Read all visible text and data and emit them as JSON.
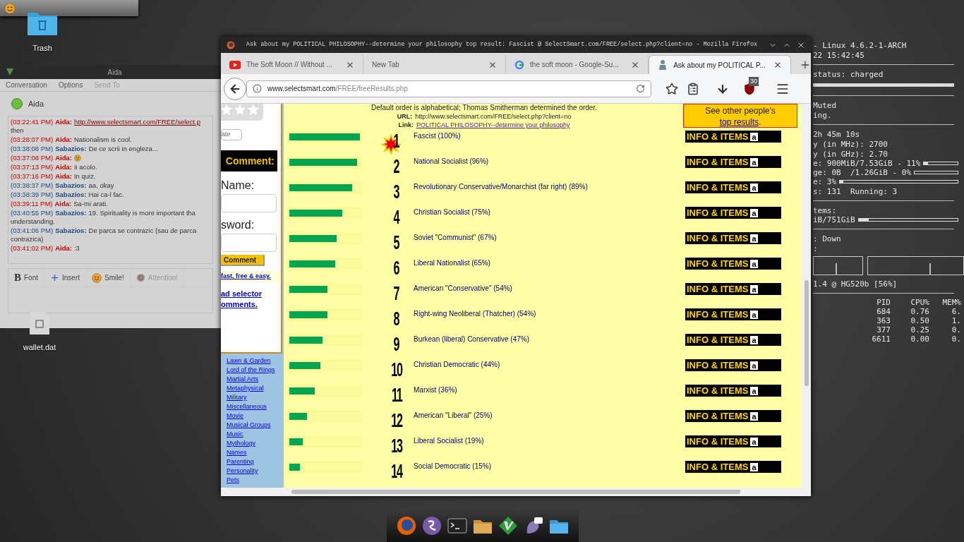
{
  "desktop": {
    "icons": [
      {
        "label": "Trash",
        "kind": "trash"
      },
      {
        "label": "wallet.dat",
        "kind": "file"
      }
    ]
  },
  "conky": [
    {
      "kind": "text",
      "text": "- Linux 4.6.2-1-ARCH"
    },
    {
      "kind": "text",
      "text": "22 15:42:45"
    },
    {
      "kind": "rule"
    },
    {
      "kind": "text",
      "text": "status: charged"
    },
    {
      "kind": "bar",
      "level": 1
    },
    {
      "kind": "rule"
    },
    {
      "kind": "text",
      "text": "Muted"
    },
    {
      "kind": "text",
      "text": "ing."
    },
    {
      "kind": "rule"
    },
    {
      "kind": "text",
      "text": "2h 45m 10s"
    },
    {
      "kind": "text",
      "text": "y (in MHz): 2700"
    },
    {
      "kind": "text",
      "text": "y (in GHz): 2.70"
    },
    {
      "kind": "meter",
      "text": "e: 900MiB/7.53GiB - 11%",
      "level": 0.11
    },
    {
      "kind": "meter",
      "text": "ge: 0B  /1.26GiB - 0%"
    },
    {
      "kind": "meter",
      "text": "e: 3%",
      "level": 0.03
    },
    {
      "kind": "text",
      "text": "s: 131  Running: 3"
    },
    {
      "kind": "rule"
    },
    {
      "kind": "text",
      "text": "tems:"
    },
    {
      "kind": "meter",
      "text": "iB/751GiB",
      "level": 0.1
    },
    {
      "kind": "rule"
    },
    {
      "kind": "text",
      "text": ": Down"
    },
    {
      "kind": "text",
      "text": ":"
    },
    {
      "kind": "graphs"
    },
    {
      "kind": "text",
      "text": "1.4 @ HG520b [56%]"
    },
    {
      "kind": "rule"
    },
    {
      "kind": "table",
      "columns": [
        "PID",
        "CPU%",
        "MEM%"
      ],
      "rows": [
        [
          "684",
          "0.76",
          "6."
        ],
        [
          "363",
          "0.50",
          "1."
        ],
        [
          "377",
          "0.25",
          "0."
        ],
        [
          "6611",
          "0.00",
          "0."
        ]
      ]
    }
  ],
  "chat": {
    "title": "Aida",
    "menu": [
      {
        "label": "Conversation",
        "disabled": false
      },
      {
        "label": "Options",
        "disabled": false
      },
      {
        "label": "Send To",
        "disabled": true
      }
    ],
    "buddy": {
      "name": "Aida",
      "online": true
    },
    "messages": [
      {
        "time": "(03:22:41 PM)",
        "sender": "Aida:",
        "kind": "received",
        "link": "http://www.selectsmart.com/FREE/select.p",
        "continuation": "then"
      },
      {
        "time": "(03:28:07 PM)",
        "sender": "Aida:",
        "kind": "received",
        "text": "Nationalism is cool."
      },
      {
        "time": "(03:38:08 PM)",
        "sender": "Sabazios:",
        "kind": "sent",
        "text": "De ce scrii in engleza..."
      },
      {
        "time": "(03:37:08 PM)",
        "sender": "Aida:",
        "kind": "received",
        "emoticon": true
      },
      {
        "time": "(03:37:13 PM)",
        "sender": "Aida:",
        "kind": "received",
        "text": "Ii acolo."
      },
      {
        "time": "(03:37:16 PM)",
        "sender": "Aida:",
        "kind": "received",
        "text": "In quiz."
      },
      {
        "time": "(03:38:37 PM)",
        "sender": "Sabazios:",
        "kind": "sent",
        "text": "aa, okay"
      },
      {
        "time": "(03:38:39 PM)",
        "sender": "Sabazios:",
        "kind": "sent",
        "text": "Hai ca-l fac."
      },
      {
        "time": "(03:39:11 PM)",
        "sender": "Aida:",
        "kind": "received",
        "text": "Sa-mi arati."
      },
      {
        "time": "(03:40:55 PM)",
        "sender": "Sabazios:",
        "kind": "sent",
        "text": "19. Spirituality is more important tha",
        "continuation": "understanding."
      },
      {
        "time": "(03:41:06 PM)",
        "sender": "Sabazios:",
        "kind": "sent",
        "text": "De parca se contrazic (sau de parca",
        "continuation": "contrazica)"
      },
      {
        "time": "(03:41:02 PM)",
        "sender": "Aida:",
        "kind": "received",
        "text": ":3"
      }
    ],
    "toolbar": [
      {
        "label": "Font",
        "kind": "font",
        "glyph": "B",
        "disabled": false
      },
      {
        "label": "Insert",
        "kind": "insert",
        "disabled": false
      },
      {
        "label": "Smile!",
        "kind": "smile",
        "disabled": false
      },
      {
        "label": "Attention!",
        "kind": "attention",
        "disabled": true
      }
    ]
  },
  "browser": {
    "title": "Ask about my POLITICAL PHILOSOPHY--determine your philosophy top result: Fascist @ SelectSmart.com/FREE/select.php?client=no - Mozilla Firefox",
    "tabs": [
      {
        "label": "The Soft Moon // Without ...",
        "kind": "video",
        "selected": false
      },
      {
        "label": "New Tab",
        "kind": "blank",
        "selected": false
      },
      {
        "label": "the soft moon - Google-Su...",
        "kind": "search",
        "selected": false
      },
      {
        "label": "Ask about my POLITICAL P...",
        "kind": "site",
        "selected": true
      }
    ],
    "url_host": "www.selectsmart.com",
    "url_path": "/FREE/freeResults.php",
    "addon_badge": "30",
    "page": {
      "sidebar": {
        "rate_button": "ate",
        "comment_heading": "Comment:",
        "name_label": "Name:",
        "password_label": "sword:",
        "comment_button": "Comment",
        "promo_link": "fast, free & easy.",
        "selector_link": [
          "ad selector",
          "omments."
        ],
        "categories": [
          "Lawn & Garden",
          "Lord of the Rings",
          "Martial Arts",
          "Metaphysical",
          "Military",
          "Miscellaneous",
          "Movie",
          "Musical Groups",
          "Music",
          "Mythology",
          "Names",
          "Parenting",
          "Personality",
          "Pets"
        ]
      },
      "header": {
        "note": "Default order is alphabetical; Thomas Smitherman determined the order.",
        "url_label": "URL:",
        "url": "http://www.selectsmart.com/FREE/select.php?client=no",
        "link_label": "Link:",
        "link": "POLITICAL PHILOSOPHY--determine your philosophy"
      },
      "other_results": {
        "before": "See other people's ",
        "link": "top results",
        "after": "."
      },
      "results": [
        {
          "rank": "1",
          "label": "Fascist (100%)",
          "level": 1,
          "starburst": true,
          "button": "INFO & ITEMS",
          "logo": "a"
        },
        {
          "rank": "2",
          "label": "National Socialist (96%)",
          "level": 0.96,
          "starburst": false,
          "button": "INFO & ITEMS",
          "logo": "a"
        },
        {
          "rank": "3",
          "label": "Revolutionary Conservative/Monarchist (far right) (89%)",
          "level": 0.89,
          "starburst": false,
          "button": "INFO & ITEMS",
          "logo": "a"
        },
        {
          "rank": "4",
          "label": "Christian Socialist (75%)",
          "level": 0.75,
          "starburst": false,
          "button": "INFO & ITEMS",
          "logo": "a"
        },
        {
          "rank": "5",
          "label": "Soviet \"Communist\" (67%)",
          "level": 0.67,
          "starburst": false,
          "button": "INFO & ITEMS",
          "logo": "a"
        },
        {
          "rank": "6",
          "label": "Liberal Nationalist (65%)",
          "level": 0.65,
          "starburst": false,
          "button": "INFO & ITEMS",
          "logo": "a"
        },
        {
          "rank": "7",
          "label": "American \"Conservative\" (54%)",
          "level": 0.54,
          "starburst": false,
          "button": "INFO & ITEMS",
          "logo": "a"
        },
        {
          "rank": "8",
          "label": "Right-wing Neoliberal (Thatcher) (54%)",
          "level": 0.54,
          "starburst": false,
          "button": "INFO & ITEMS",
          "logo": "a"
        },
        {
          "rank": "9",
          "label": "Burkean (liberal) Conservative (47%)",
          "level": 0.47,
          "starburst": false,
          "button": "INFO & ITEMS",
          "logo": "a"
        },
        {
          "rank": "10",
          "label": "Christian Democratic (44%)",
          "level": 0.44,
          "starburst": false,
          "button": "INFO & ITEMS",
          "logo": "a"
        },
        {
          "rank": "11",
          "label": "Marxist (36%)",
          "level": 0.36,
          "starburst": false,
          "button": "INFO & ITEMS",
          "logo": "a"
        },
        {
          "rank": "12",
          "label": "American \"Liberal\" (25%)",
          "level": 0.25,
          "starburst": false,
          "button": "INFO & ITEMS",
          "logo": "a"
        },
        {
          "rank": "13",
          "label": "Liberal Socialist (19%)",
          "level": 0.19,
          "starburst": false,
          "button": "INFO & ITEMS",
          "logo": "a"
        },
        {
          "rank": "14",
          "label": "Social Democratic (15%)",
          "level": 0.15,
          "starburst": false,
          "button": "INFO & ITEMS",
          "logo": "a"
        }
      ]
    }
  },
  "dock": [
    {
      "kind": "firefox"
    },
    {
      "kind": "emacs"
    },
    {
      "kind": "terminal"
    },
    {
      "kind": "files"
    },
    {
      "kind": "vim"
    },
    {
      "kind": "pidgin"
    },
    {
      "kind": "folder"
    }
  ]
}
